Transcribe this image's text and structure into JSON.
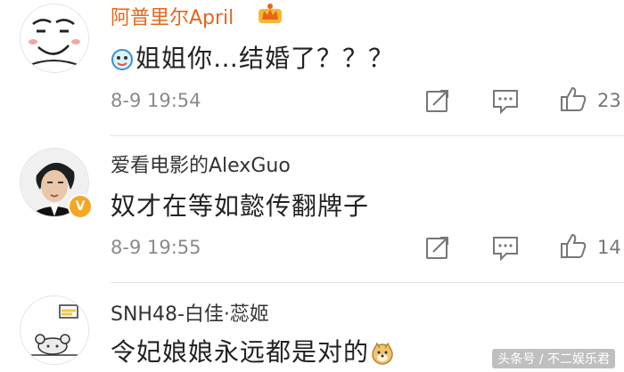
{
  "comments": [
    {
      "username": "阿普里尔April",
      "username_color": "#e8641b",
      "badge_icon": "crown-icon",
      "avatar_icon": "meme-face-avatar",
      "text_emoji": "face-emoji",
      "text": "姐姐你…结婚了？？？",
      "time": "8-9 19:54",
      "likes": "23"
    },
    {
      "username": "爱看电影的AlexGuo",
      "username_color": "#333333",
      "avatar_icon": "person-photo-avatar",
      "verified_icon": "verified-v-icon",
      "text": "奴才在等如懿传翻牌子",
      "time": "8-9 19:55",
      "likes": "14"
    },
    {
      "username": "SNH48-白佳·蕊姬",
      "username_color": "#333333",
      "avatar_icon": "cartoon-mouse-avatar",
      "text": "令妃娘娘永远都是对的",
      "text_emoji": "doge-emoji"
    }
  ],
  "icons": {
    "share": "share-icon",
    "comment": "comment-icon",
    "like": "thumbs-up-icon"
  },
  "watermark": "头条号 / 不二娱乐君"
}
